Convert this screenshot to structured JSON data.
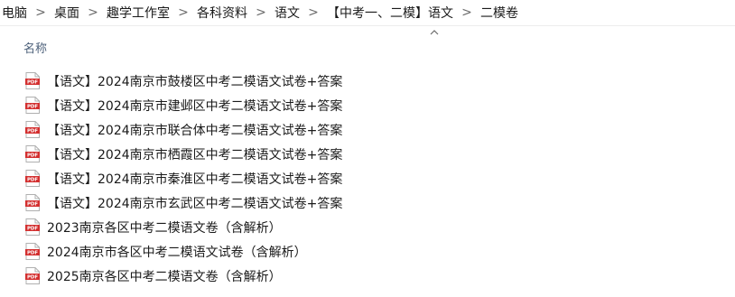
{
  "breadcrumb": {
    "items": [
      "电脑",
      "桌面",
      "趣学工作室",
      "各科资料",
      "语文",
      "【中考一、二模】语文",
      "二模卷"
    ],
    "separator": ">"
  },
  "column_header": {
    "name_label": "名称",
    "sort": "ascending",
    "sort_icon": "chevron-up-icon"
  },
  "files": [
    {
      "name": "【语文】2024南京市鼓楼区中考二模语文试卷+答案",
      "icon": "pdf-file-icon",
      "icon_text": "PDF"
    },
    {
      "name": "【语文】2024南京市建邺区中考二模语文试卷+答案",
      "icon": "pdf-file-icon",
      "icon_text": "PDF"
    },
    {
      "name": "【语文】2024南京市联合体中考二模语文试卷+答案",
      "icon": "pdf-file-icon",
      "icon_text": "PDF"
    },
    {
      "name": "【语文】2024南京市栖霞区中考二模语文试卷+答案",
      "icon": "pdf-file-icon",
      "icon_text": "PDF"
    },
    {
      "name": "【语文】2024南京市秦淮区中考二模语文试卷+答案",
      "icon": "pdf-file-icon",
      "icon_text": "PDF"
    },
    {
      "name": "【语文】2024南京市玄武区中考二模语文试卷+答案",
      "icon": "pdf-file-icon",
      "icon_text": "PDF"
    },
    {
      "name": "2023南京各区中考二模语文卷（含解析）",
      "icon": "pdf-file-icon",
      "icon_text": "PDF"
    },
    {
      "name": "2024南京市各区中考二模语文试卷（含解析）",
      "icon": "pdf-file-icon",
      "icon_text": "PDF"
    },
    {
      "name": "2025南京各区中考二模语文卷（含解析）",
      "icon": "pdf-file-icon",
      "icon_text": "PDF"
    }
  ],
  "colors": {
    "pdf_red": "#d32f2f",
    "header_text": "#4c607a",
    "text": "#1a1a1a"
  }
}
